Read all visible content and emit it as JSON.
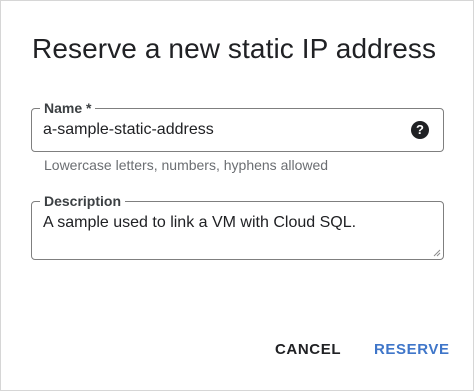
{
  "dialog": {
    "title": "Reserve a new static IP address"
  },
  "name_field": {
    "label": "Name *",
    "value": "a-sample-static-address",
    "help_icon": "help-icon",
    "hint": "Lowercase letters, numbers, hyphens allowed"
  },
  "description_field": {
    "label": "Description",
    "value": "A sample used to link a VM with Cloud SQL."
  },
  "actions": {
    "cancel_label": "CANCEL",
    "reserve_label": "RESERVE"
  },
  "colors": {
    "primary_action": "#3f76c9",
    "text": "#202124",
    "field_border": "#7f7f7f"
  }
}
